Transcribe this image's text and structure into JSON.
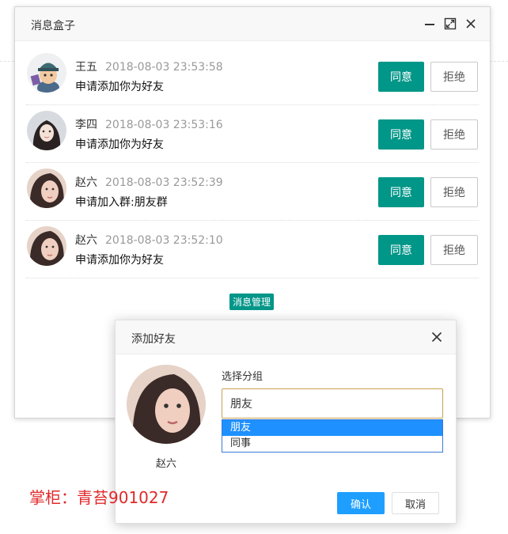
{
  "msgbox": {
    "title": "消息盒子",
    "items": [
      {
        "name": "王五",
        "time": "2018-08-03 23:53:58",
        "content": "申请添加你为好友",
        "agree": "同意",
        "refuse": "拒绝"
      },
      {
        "name": "李四",
        "time": "2018-08-03 23:53:16",
        "content": "申请添加你为好友",
        "agree": "同意",
        "refuse": "拒绝"
      },
      {
        "name": "赵六",
        "time": "2018-08-03 23:52:39",
        "content": "申请加入群:朋友群",
        "agree": "同意",
        "refuse": "拒绝"
      },
      {
        "name": "赵六",
        "time": "2018-08-03 23:52:10",
        "content": "申请添加你为好友",
        "agree": "同意",
        "refuse": "拒绝"
      }
    ],
    "manage_label": "消息管理"
  },
  "dialog": {
    "title": "添加好友",
    "user_name": "赵六",
    "group_label": "选择分组",
    "group_value": "朋友",
    "options": [
      "朋友",
      "同事"
    ],
    "confirm": "确认",
    "cancel": "取消"
  },
  "watermark": "掌柜：青苔901027",
  "colors": {
    "primary": "#009688",
    "confirm": "#1e9fff",
    "option_selected": "#1e90ff",
    "watermark": "#e0292b"
  },
  "icons": [
    "minimize-icon",
    "maximize-icon",
    "close-icon"
  ]
}
